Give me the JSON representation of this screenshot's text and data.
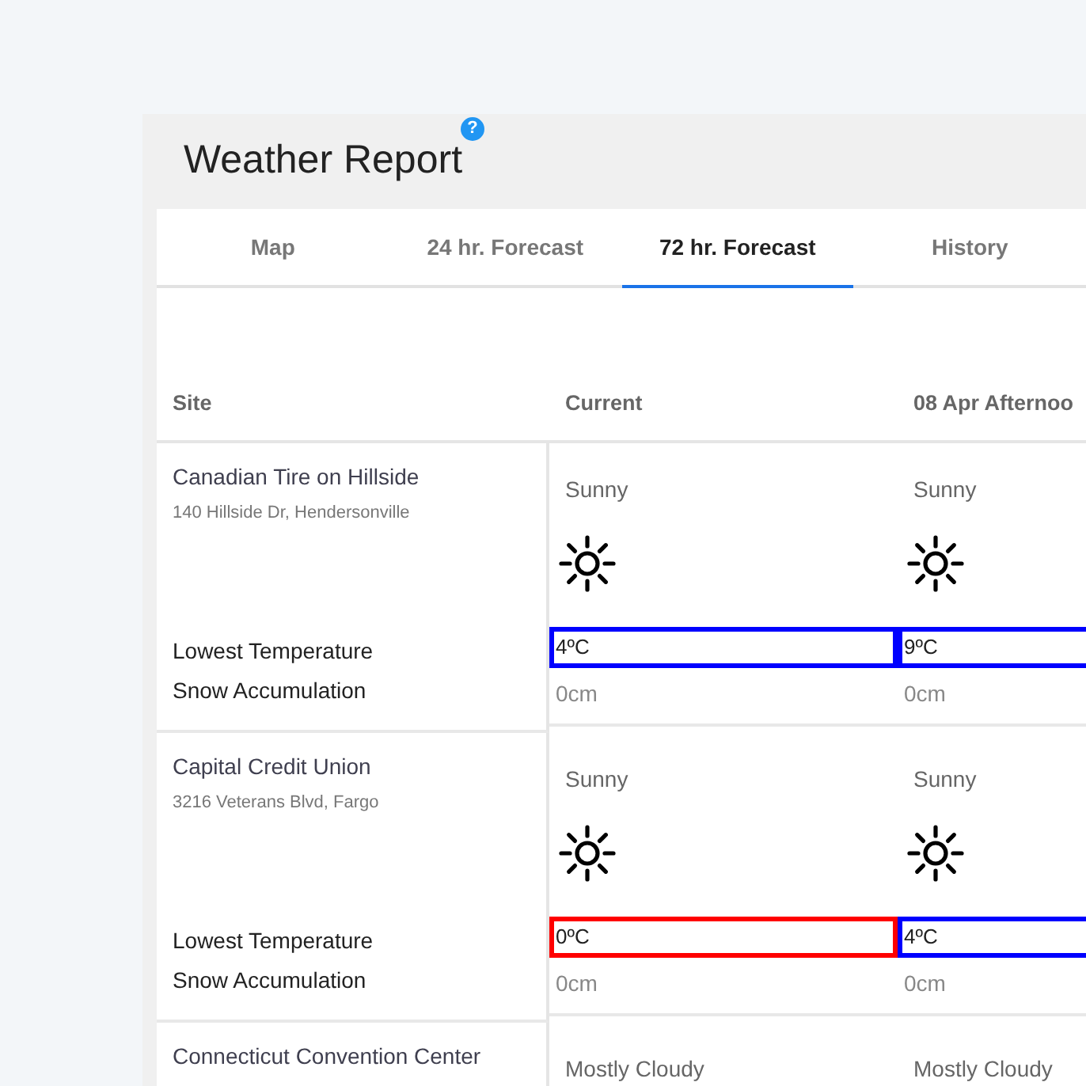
{
  "window": {
    "title": "Weather Report",
    "help": "?"
  },
  "tabs": [
    {
      "label": "Map",
      "selected": false
    },
    {
      "label": "24 hr. Forecast",
      "selected": false
    },
    {
      "label": "72 hr. Forecast",
      "selected": true
    },
    {
      "label": "History",
      "selected": false
    }
  ],
  "table": {
    "columns": [
      "Site",
      "Current",
      "08 Apr Afternoo"
    ],
    "rows": [
      {
        "name": "Canadian Tire on Hillside",
        "address": "140 Hillside Dr, Hendersonville",
        "low_label": "Lowest Temperature",
        "snow_label": "Snow Accumulation",
        "forecasts": [
          {
            "condition": "Sunny",
            "kind": "sunny",
            "low": "4ºC",
            "color": "#0000ff",
            "snow": "0cm"
          },
          {
            "condition": "Sunny",
            "kind": "sunny",
            "low": "9ºC",
            "color": "#0000ff",
            "snow": "0cm"
          }
        ]
      },
      {
        "name": "Capital Credit Union",
        "address": "3216 Veterans Blvd, Fargo",
        "low_label": "Lowest Temperature",
        "snow_label": "Snow Accumulation",
        "forecasts": [
          {
            "condition": "Sunny",
            "kind": "sunny",
            "low": "0ºC",
            "color": "#ff0000",
            "snow": "0cm"
          },
          {
            "condition": "Sunny",
            "kind": "sunny",
            "low": "4ºC",
            "color": "#0000ff",
            "snow": "0cm"
          }
        ]
      },
      {
        "name": "Connecticut Convention Center",
        "forecasts": [
          {
            "condition": "Mostly Cloudy"
          },
          {
            "condition": "Mostly Cloudy"
          }
        ]
      }
    ]
  }
}
